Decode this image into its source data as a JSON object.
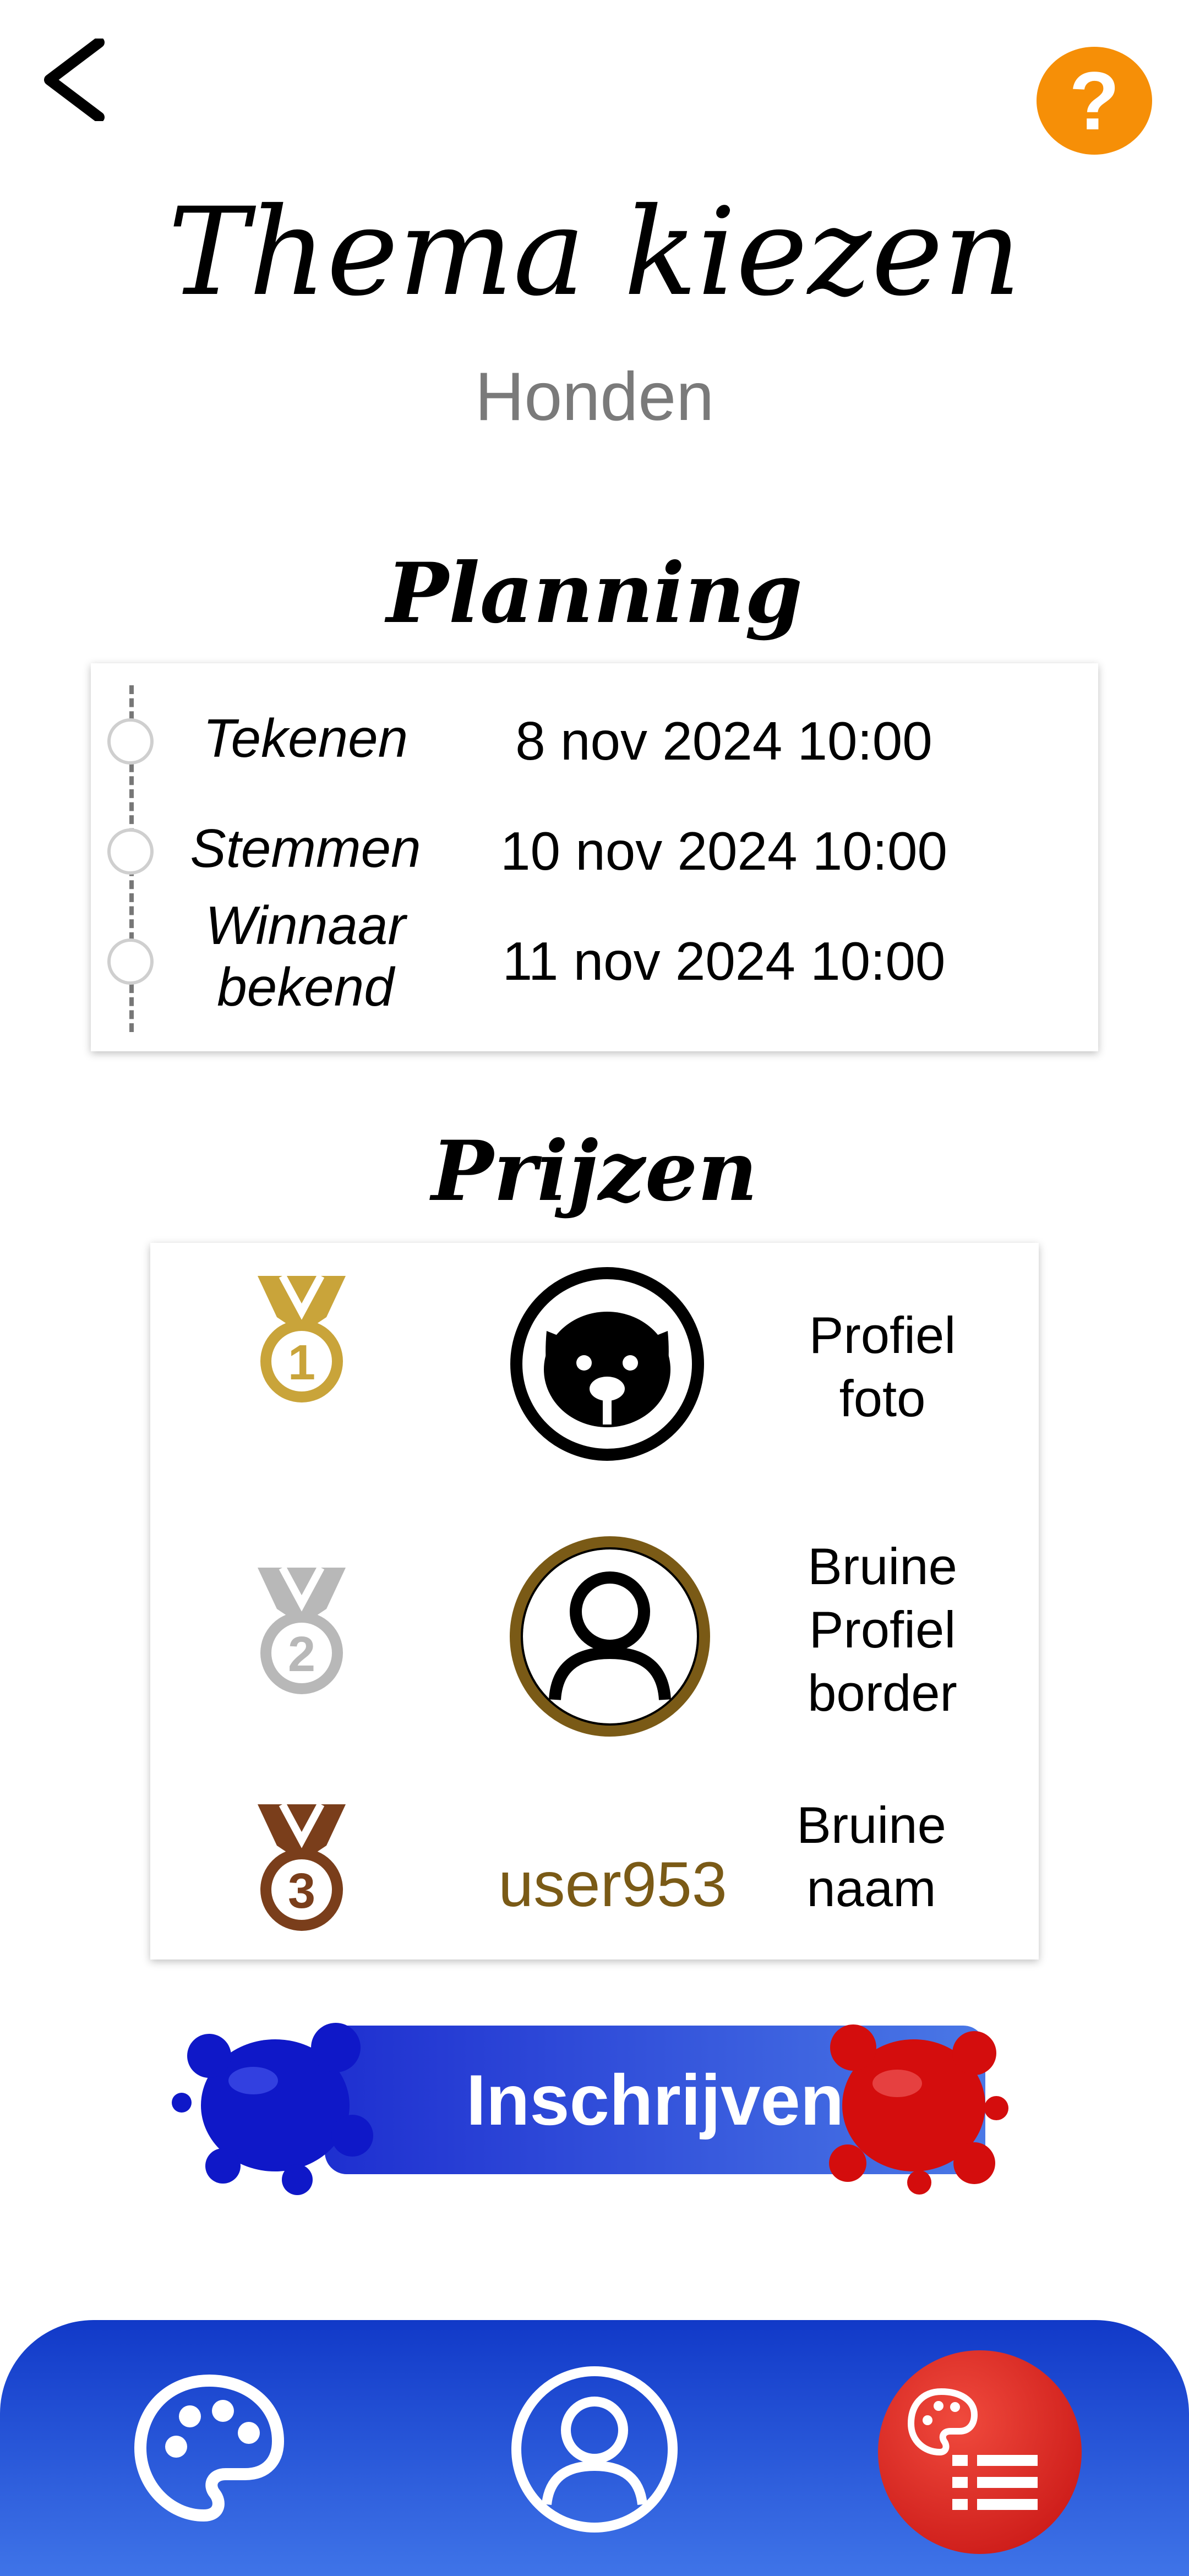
{
  "header": {
    "title": "Thema kiezen",
    "subtitle": "Honden",
    "help_label": "?"
  },
  "planning": {
    "title": "Planning",
    "rows": [
      {
        "label": "Tekenen",
        "date": "8 nov 2024 10:00"
      },
      {
        "label": "Stemmen",
        "date": "10 nov 2024 10:00"
      },
      {
        "label": "Winnaar bekend",
        "date": "11 nov 2024 10:00"
      }
    ]
  },
  "prizes": {
    "title": "Prijzen",
    "items": [
      {
        "rank": "1",
        "medal_color": "#c9a43a",
        "reward_icon": "dog-icon",
        "description": "Profiel foto"
      },
      {
        "rank": "2",
        "medal_color": "#b8b8b8",
        "reward_icon": "profile-border-icon",
        "description": "Bruine Profiel border"
      },
      {
        "rank": "3",
        "medal_color": "#7a3e1b",
        "reward_text": "user953",
        "description": "Bruine naam"
      }
    ]
  },
  "register": {
    "label": "Inschrijven"
  },
  "bottom_nav": {
    "items": [
      "palette-icon",
      "profile-icon",
      "themes-list-icon"
    ]
  },
  "colors": {
    "accent_orange": "#f68f07",
    "nav_blue": "#1e3fd0",
    "active_red": "#d21919",
    "brown_text": "#7a5a16"
  }
}
